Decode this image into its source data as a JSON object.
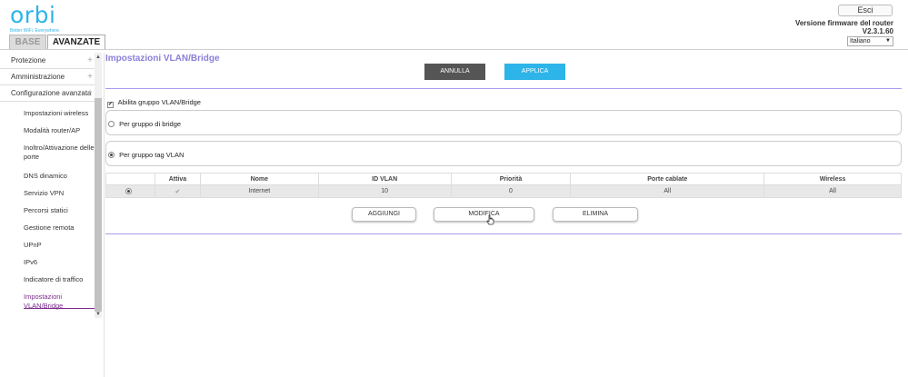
{
  "brand": {
    "name": "orbi",
    "tagline": "Better WiFi. Everywhere."
  },
  "tabs": [
    {
      "label": "BASE"
    },
    {
      "label": "AVANZATE"
    }
  ],
  "header": {
    "logout_label": "Esci",
    "firmware_label": "Versione firmware del router",
    "firmware_value": "V2.3.1.60",
    "language": "Italiano"
  },
  "sidebar": {
    "groups": [
      {
        "label": "Protezione"
      },
      {
        "label": "Amministrazione"
      },
      {
        "label": "Configurazione avanzata"
      }
    ],
    "items": [
      {
        "label": "Impostazioni wireless"
      },
      {
        "label": "Modalità router/AP"
      },
      {
        "label": "Inoltro/Attivazione delle porte"
      },
      {
        "label": "DNS dinamico"
      },
      {
        "label": "Servizio VPN"
      },
      {
        "label": "Percorsi statici"
      },
      {
        "label": "Gestione remota"
      },
      {
        "label": "UPnP"
      },
      {
        "label": "IPv6"
      },
      {
        "label": "Indicatore di traffico"
      },
      {
        "label": "Impostazioni VLAN/Bridge"
      }
    ]
  },
  "main": {
    "title": "Impostazioni VLAN/Bridge",
    "cancel_label": "ANNULLA",
    "apply_label": "APPLICA",
    "enable_label": "Abilita gruppo VLAN/Bridge",
    "bridge_group_label": "Per gruppo di bridge",
    "vlan_tag_group_label": "Per gruppo tag VLAN",
    "table": {
      "headers": [
        "",
        "Attiva",
        "Nome",
        "ID VLAN",
        "Priorità",
        "Porte cablate",
        "Wireless"
      ],
      "rows": [
        {
          "name": "Internet",
          "vlan_id": "10",
          "priority": "0",
          "wired_ports": "All",
          "wireless": "All"
        }
      ]
    },
    "add_label": "AGGIUNGI",
    "edit_label": "MODIFICA",
    "delete_label": "ELIMINA"
  },
  "colors": {
    "brand_blue": "#2db4e8",
    "title_purple": "#8a7fd8",
    "active_item": "#7b2a8c",
    "cancel_gray": "#555555"
  }
}
